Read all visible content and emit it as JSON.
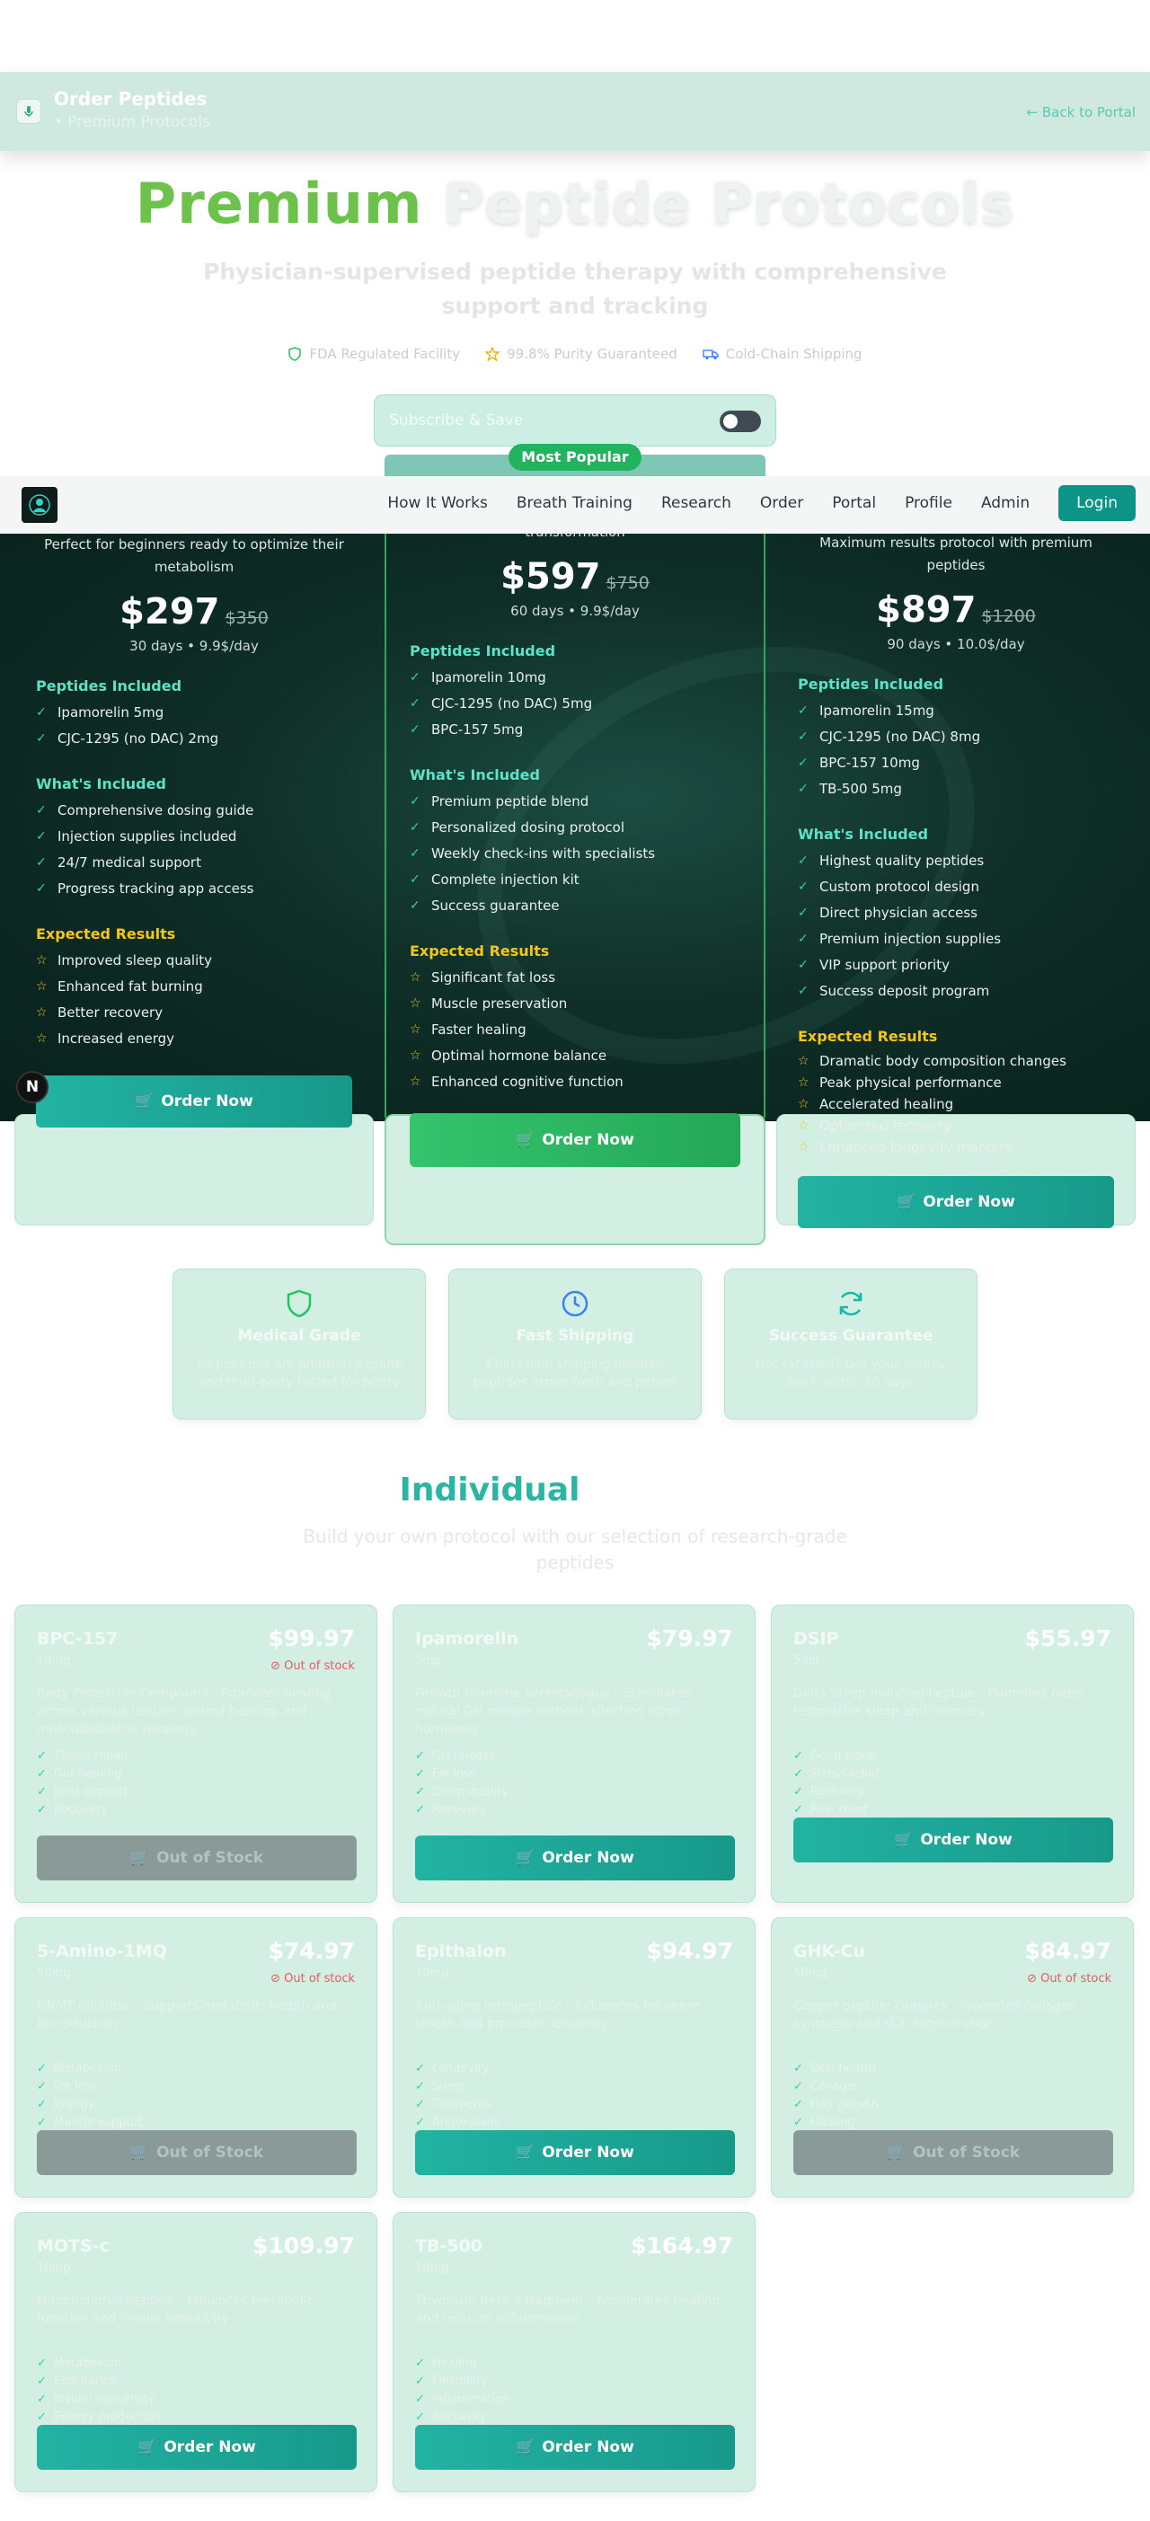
{
  "header": {
    "title": "Order Peptides",
    "subtitle": "• Premium Protocols",
    "back_link": "← Back to Portal"
  },
  "hero": {
    "title_word1": "Premium",
    "title_word2": "Peptide Protocols",
    "subtitle": "Physician-supervised peptide therapy with comprehensive support and tracking",
    "badges": [
      "FDA Regulated Facility",
      "99.8% Purity Guaranteed",
      "Cold-Chain Shipping"
    ]
  },
  "subscribe": {
    "label": "Subscribe & Save"
  },
  "popular_badge": "Most Popular",
  "nav": {
    "links": [
      "How It Works",
      "Breath Training",
      "Research",
      "Order",
      "Portal",
      "Profile",
      "Admin"
    ],
    "login": "Login"
  },
  "plans": [
    {
      "desc": "Perfect for beginners ready to optimize their metabolism",
      "price": "$297",
      "old_price": "$350",
      "per": "30 days • 9.9$/day",
      "peptides_title": "Peptides Included",
      "peptides": [
        "Ipamorelin 5mg",
        "CJC-1295 (no DAC) 2mg"
      ],
      "included_title": "What's Included",
      "included": [
        "Comprehensive dosing guide",
        "Injection supplies included",
        "24/7 medical support",
        "Progress tracking app access"
      ],
      "results_title": "Expected Results",
      "results": [
        "Improved sleep quality",
        "Enhanced fat burning",
        "Better recovery",
        "Increased energy"
      ],
      "button": "Order Now"
    },
    {
      "desc": "transformation",
      "price": "$597",
      "old_price": "$750",
      "per": "60 days • 9.9$/day",
      "peptides_title": "Peptides Included",
      "peptides": [
        "Ipamorelin 10mg",
        "CJC-1295 (no DAC) 5mg",
        "BPC-157 5mg"
      ],
      "included_title": "What's Included",
      "included": [
        "Premium peptide blend",
        "Personalized dosing protocol",
        "Weekly check-ins with specialists",
        "Complete injection kit",
        "Success guarantee"
      ],
      "results_title": "Expected Results",
      "results": [
        "Significant fat loss",
        "Muscle preservation",
        "Faster healing",
        "Optimal hormone balance",
        "Enhanced cognitive function"
      ],
      "button": "Order Now"
    },
    {
      "desc": "Maximum results protocol with premium peptides",
      "price": "$897",
      "old_price": "$1200",
      "per": "90 days • 10.0$/day",
      "peptides_title": "Peptides Included",
      "peptides": [
        "Ipamorelin 15mg",
        "CJC-1295 (no DAC) 8mg",
        "BPC-157 10mg",
        "TB-500 5mg"
      ],
      "included_title": "What's Included",
      "included": [
        "Highest quality peptides",
        "Custom protocol design",
        "Direct physician access",
        "Premium injection supplies",
        "VIP support priority",
        "Success deposit program"
      ],
      "results_title": "Expected Results",
      "results": [
        "Dramatic body composition changes",
        "Peak physical performance",
        "Accelerated healing",
        "Optimized recovery",
        "Enhanced longevity markers"
      ],
      "button": "Order Now"
    }
  ],
  "features": [
    {
      "icon": "shield-icon",
      "title": "Medical Grade",
      "desc": "All peptides are pharmacy-grade and third-party tested for purity"
    },
    {
      "icon": "clock-icon",
      "title": "Fast Shipping",
      "desc": "Cold-chain shipping ensures peptides arrive fresh and potent"
    },
    {
      "icon": "refresh-icon",
      "title": "Success Guarantee",
      "desc": "Not satisfied? Get your money back within 30 days"
    }
  ],
  "individual": {
    "title": "Individual",
    "subtitle": "Build your own protocol with our selection of research-grade peptides",
    "products": [
      {
        "name": "BPC-157",
        "dose": "10mg",
        "price": "$99.97",
        "status": "Out of stock",
        "desc": "Body Protection Compound - Promotes healing across various tissues, wound healing, and musculoskeletal recovery",
        "bullets": [
          "Tissue repair",
          "Gut healing",
          "Joint support",
          "Recovery"
        ],
        "button": "Out of Stock"
      },
      {
        "name": "Ipamorelin",
        "dose": "5mg",
        "price": "$79.97",
        "status": "",
        "desc": "Growth hormone secretagogue - Stimulates natural GH release without affecting other hormones",
        "bullets": [
          "GH release",
          "Fat loss",
          "Sleep quality",
          "Recovery"
        ],
        "button": "Order Now"
      },
      {
        "name": "DSIP",
        "dose": "5mg",
        "price": "$55.97",
        "status": "",
        "desc": "Delta Sleep-Inducing Peptide - Promotes deep restorative sleep and recovery",
        "bullets": [
          "Deep sleep",
          "Stress relief",
          "Recovery",
          "Pain relief"
        ],
        "button": "Order Now"
      },
      {
        "name": "5-Amino-1MQ",
        "dose": "50mg",
        "price": "$74.97",
        "status": "Out of stock",
        "desc": "NNMT inhibitor - Supports metabolic health and fat reduction",
        "bullets": [
          "Metabolism",
          "Fat loss",
          "Energy",
          "Muscle support"
        ],
        "button": "Out of Stock"
      },
      {
        "name": "Epithalon",
        "dose": "10mg",
        "price": "$94.97",
        "status": "",
        "desc": "Anti-aging tetrapeptide - Influences telomere length and promotes longevity",
        "bullets": [
          "Longevity",
          "Sleep",
          "Telomeres",
          "Antioxidant"
        ],
        "button": "Order Now"
      },
      {
        "name": "GHK-Cu",
        "dose": "50mg",
        "price": "$84.97",
        "status": "Out of stock",
        "desc": "Copper peptide complex - Promotes collagen synthesis and skin regeneration",
        "bullets": [
          "Skin health",
          "Collagen",
          "Hair growth",
          "Healing"
        ],
        "button": "Out of Stock"
      },
      {
        "name": "MOTS-c",
        "dose": "10mg",
        "price": "$109.97",
        "status": "",
        "desc": "Mitochondrial peptide - Enhances metabolic function and insulin sensitivity",
        "bullets": [
          "Metabolism",
          "Endurance",
          "Insulin sensitivity",
          "Energy production"
        ],
        "button": "Order Now"
      },
      {
        "name": "TB-500",
        "dose": "10mg",
        "price": "$164.97",
        "status": "",
        "desc": "Thymosin Beta-4 fragment - Accelerates healing and reduces inflammation",
        "bullets": [
          "Healing",
          "Flexibility",
          "Inflammation",
          "Recovery"
        ],
        "button": "Order Now"
      }
    ]
  },
  "colors": {
    "brand_teal": "#0d9488",
    "accent_green": "#22b35e",
    "out_of_stock": "#e35d5d"
  }
}
